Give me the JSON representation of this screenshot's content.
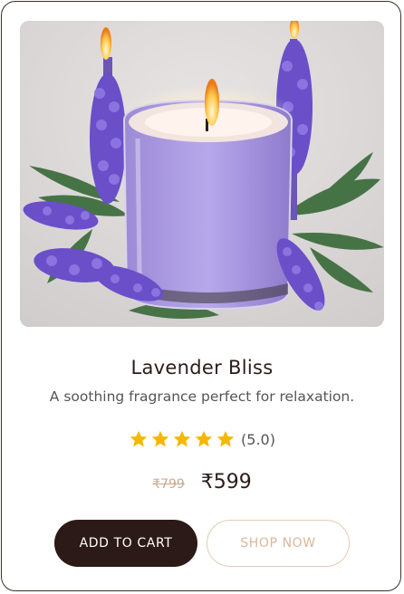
{
  "product": {
    "image_alt": "Lavender scented candle with lavender sprigs",
    "title": "Lavender Bliss",
    "description": "A soothing fragrance perfect for relaxation.",
    "rating": 5.0,
    "stars_filled": 5,
    "stars_total": 5,
    "rating_text": "(5.0)",
    "old_price": "₹799",
    "price": "₹599"
  },
  "actions": {
    "add_to_cart": "ADD TO CART",
    "shop_now": "SHOP NOW"
  },
  "colors": {
    "accent_dark": "#2b1a17",
    "accent_light": "#d9b79a",
    "star": "#f5b800"
  },
  "icons": {
    "star": "star-icon"
  }
}
